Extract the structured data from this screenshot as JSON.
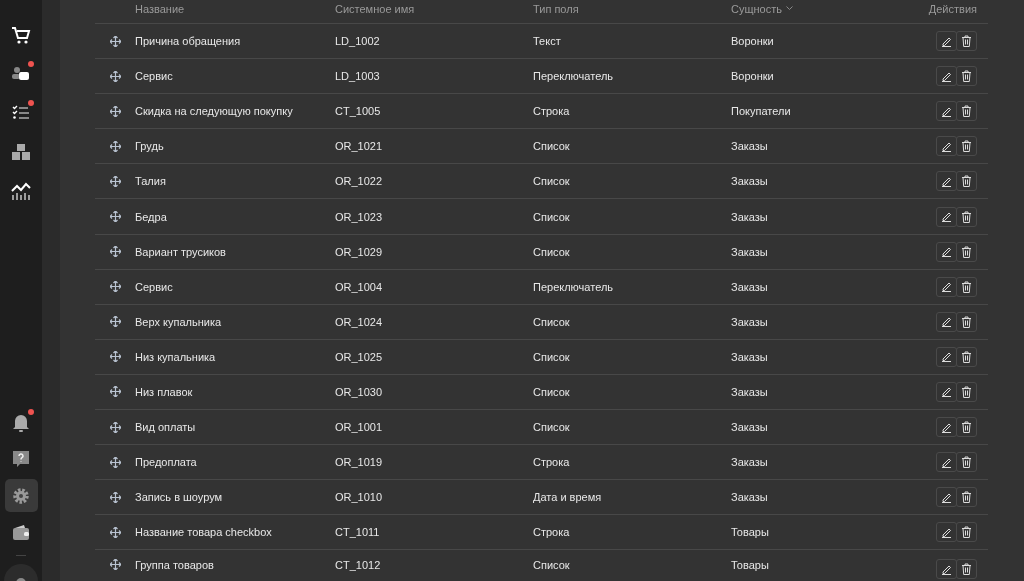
{
  "sidebar": {
    "top_items": [
      {
        "kind": "cart",
        "selected": false,
        "badge": false
      },
      {
        "kind": "chat",
        "selected": false,
        "badge": true
      },
      {
        "kind": "tasks",
        "selected": false,
        "badge": true
      },
      {
        "kind": "boxes",
        "selected": false,
        "badge": false
      },
      {
        "kind": "chart",
        "selected": false,
        "badge": false
      }
    ],
    "bottom_items": [
      {
        "kind": "bell",
        "selected": false,
        "badge": true
      },
      {
        "kind": "help",
        "selected": false,
        "badge": false
      },
      {
        "kind": "gear",
        "selected": true,
        "badge": false
      },
      {
        "kind": "wallet",
        "selected": false,
        "badge": false
      }
    ]
  },
  "table": {
    "columns": [
      {
        "label": "Название",
        "sorted": false
      },
      {
        "label": "Системное имя",
        "sorted": false
      },
      {
        "label": "Тип поля",
        "sorted": false
      },
      {
        "label": "Сущность",
        "sorted": true
      },
      {
        "label": "Действия",
        "sorted": false
      }
    ],
    "rows": [
      {
        "name": "Причина обращения",
        "system_name": "LD_1002",
        "field_type": "Текст",
        "entity": "Воронки"
      },
      {
        "name": "Сервис",
        "system_name": "LD_1003",
        "field_type": "Переключатель",
        "entity": "Воронки"
      },
      {
        "name": "Скидка на следующую покупку",
        "system_name": "CT_1005",
        "field_type": "Строка",
        "entity": "Покупатели"
      },
      {
        "name": "Грудь",
        "system_name": "OR_1021",
        "field_type": "Список",
        "entity": "Заказы"
      },
      {
        "name": "Талия",
        "system_name": "OR_1022",
        "field_type": "Список",
        "entity": "Заказы"
      },
      {
        "name": "Бедра",
        "system_name": "OR_1023",
        "field_type": "Список",
        "entity": "Заказы"
      },
      {
        "name": "Вариант трусиков",
        "system_name": "OR_1029",
        "field_type": "Список",
        "entity": "Заказы"
      },
      {
        "name": "Сервис",
        "system_name": "OR_1004",
        "field_type": "Переключатель",
        "entity": "Заказы"
      },
      {
        "name": "Верх купальника",
        "system_name": "OR_1024",
        "field_type": "Список",
        "entity": "Заказы"
      },
      {
        "name": "Низ купальника",
        "system_name": "OR_1025",
        "field_type": "Список",
        "entity": "Заказы"
      },
      {
        "name": "Низ плавок",
        "system_name": "OR_1030",
        "field_type": "Список",
        "entity": "Заказы"
      },
      {
        "name": "Вид оплаты",
        "system_name": "OR_1001",
        "field_type": "Список",
        "entity": "Заказы"
      },
      {
        "name": "Предоплата",
        "system_name": "OR_1019",
        "field_type": "Строка",
        "entity": "Заказы"
      },
      {
        "name": "Запись в шоурум",
        "system_name": "OR_1010",
        "field_type": "Дата и время",
        "entity": "Заказы"
      },
      {
        "name": "Название товара checkbox",
        "system_name": "CT_1011",
        "field_type": "Строка",
        "entity": "Товары"
      },
      {
        "name": "Группа товаров",
        "system_name": "CT_1012",
        "field_type": "Список",
        "entity": "Товары"
      }
    ]
  }
}
